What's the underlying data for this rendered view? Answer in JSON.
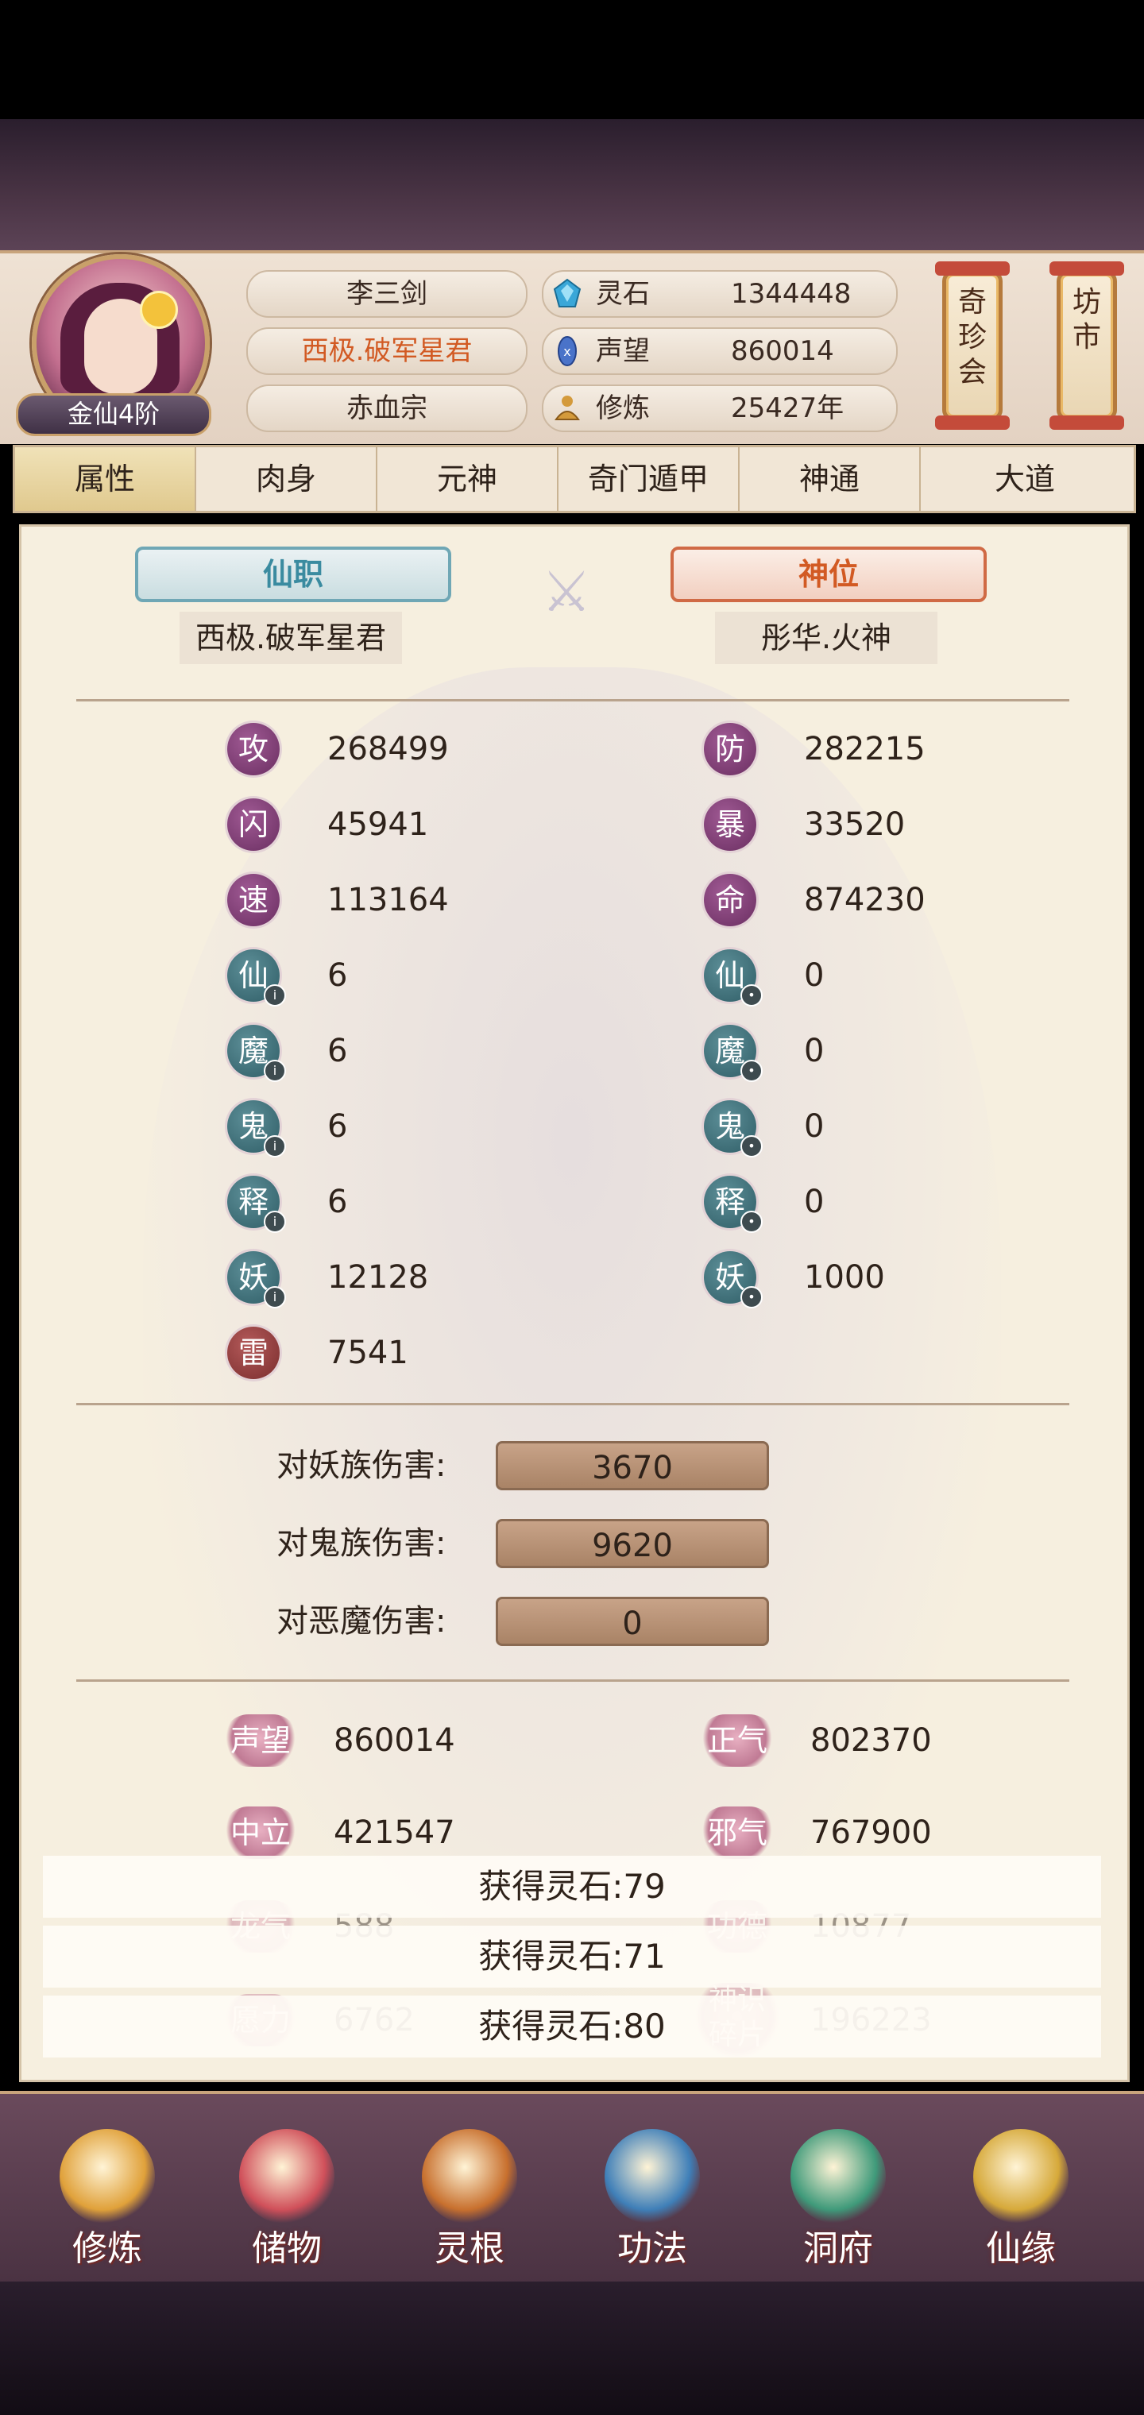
{
  "player": {
    "name": "李三剑",
    "title": "西极.破军星君",
    "sect": "赤血宗",
    "rank": "金仙4阶"
  },
  "resources": [
    {
      "label": "灵石",
      "value": "1344448",
      "icon": "spirit-stone-icon",
      "color": "#3aa7d8"
    },
    {
      "label": "声望",
      "value": "860014",
      "icon": "reputation-icon",
      "color": "#4a73c9"
    },
    {
      "label": "修炼",
      "value": "25427年",
      "icon": "meditation-icon",
      "color": "#d49a3b"
    }
  ],
  "side_buttons": {
    "treasure_fair": "奇珍会",
    "market": "坊市"
  },
  "tabs": [
    "属性",
    "肉身",
    "元神",
    "奇门遁甲",
    "神通",
    "大道"
  ],
  "active_tab": "属性",
  "positions": {
    "official_label": "仙职",
    "official_value": "西极.破军星君",
    "divine_label": "神位",
    "divine_value": "彤华.火神"
  },
  "stats_left": [
    {
      "icon": "攻",
      "value": "268499",
      "style": "purple",
      "badge": ""
    },
    {
      "icon": "闪",
      "value": "45941",
      "style": "purple",
      "badge": ""
    },
    {
      "icon": "速",
      "value": "113164",
      "style": "purple",
      "badge": ""
    },
    {
      "icon": "仙",
      "value": "6",
      "style": "teal",
      "badge": "!"
    },
    {
      "icon": "魔",
      "value": "6",
      "style": "teal",
      "badge": "!"
    },
    {
      "icon": "鬼",
      "value": "6",
      "style": "teal",
      "badge": "!"
    },
    {
      "icon": "释",
      "value": "6",
      "style": "teal",
      "badge": "!"
    },
    {
      "icon": "妖",
      "value": "12128",
      "style": "teal",
      "badge": "!"
    },
    {
      "icon": "雷",
      "value": "7541",
      "style": "red",
      "badge": ""
    }
  ],
  "stats_right": [
    {
      "icon": "防",
      "value": "282215",
      "style": "purple",
      "badge": ""
    },
    {
      "icon": "暴",
      "value": "33520",
      "style": "purple",
      "badge": ""
    },
    {
      "icon": "命",
      "value": "874230",
      "style": "purple",
      "badge": ""
    },
    {
      "icon": "仙",
      "value": "0",
      "style": "teal",
      "badge": "o"
    },
    {
      "icon": "魔",
      "value": "0",
      "style": "teal",
      "badge": "o"
    },
    {
      "icon": "鬼",
      "value": "0",
      "style": "teal",
      "badge": "o"
    },
    {
      "icon": "释",
      "value": "0",
      "style": "teal",
      "badge": "o"
    },
    {
      "icon": "妖",
      "value": "1000",
      "style": "teal",
      "badge": "o"
    }
  ],
  "damage": [
    {
      "label": "对妖族伤害:",
      "value": "3670"
    },
    {
      "label": "对鬼族伤害:",
      "value": "9620"
    },
    {
      "label": "对恶魔伤害:",
      "value": "0"
    }
  ],
  "reputation_left": [
    {
      "label": "声望",
      "value": "860014"
    },
    {
      "label": "中立",
      "value": "421547"
    },
    {
      "label": "龙气",
      "value": "588"
    },
    {
      "label": "愿力",
      "value": "6762"
    }
  ],
  "reputation_right": [
    {
      "label": "正气",
      "value": "802370"
    },
    {
      "label": "邪气",
      "value": "767900"
    },
    {
      "label": "功德",
      "value": "10877"
    },
    {
      "label": "神识碎片",
      "value": "196223"
    }
  ],
  "toasts": [
    "获得灵石:79",
    "获得灵石:71",
    "获得灵石:80"
  ],
  "bottom_nav": [
    {
      "label": "修炼",
      "icon": "cultivate-icon",
      "color": "#e0a13a"
    },
    {
      "label": "储物",
      "icon": "storage-bag-icon",
      "color": "#d0505a"
    },
    {
      "label": "灵根",
      "icon": "spirit-root-icon",
      "color": "#c8702e"
    },
    {
      "label": "功法",
      "icon": "technique-book-icon",
      "color": "#3f7fb8"
    },
    {
      "label": "洞府",
      "icon": "cave-residence-icon",
      "color": "#3f9a7a"
    },
    {
      "label": "仙缘",
      "icon": "fate-gourd-icon",
      "color": "#d6a93a"
    }
  ],
  "colors": {
    "accent_orange": "#d25a23",
    "accent_teal": "#3a8ba0",
    "panel_bg": "#f6efdf"
  }
}
